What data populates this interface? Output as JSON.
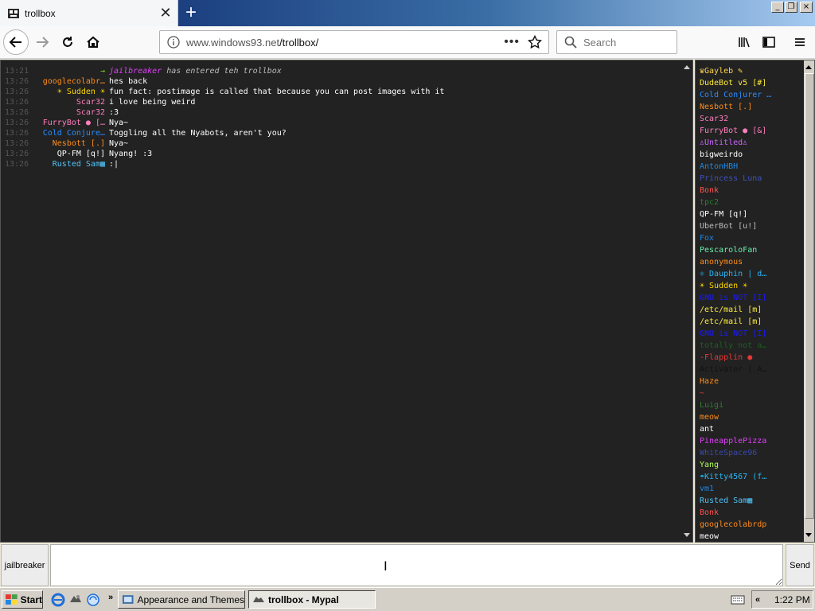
{
  "browser": {
    "tab_title": "trollbox",
    "new_tab": "+",
    "close_tab": "✕",
    "url_host": "www.windows93.net",
    "url_path": "/trollbox/",
    "url_dots": "•••",
    "search_placeholder": "Search",
    "window_controls": [
      "_",
      "❐",
      "×"
    ]
  },
  "chat": {
    "messages": [
      {
        "time": "13:21",
        "nick": "→",
        "text": "jailbreaker has entered teh trollbox",
        "system": true,
        "nick_color": "#7ddc1f"
      },
      {
        "time": "13:26",
        "nick": "googlecolabr…",
        "text": "hes back",
        "nick_color": "#ff8c1a"
      },
      {
        "time": "13:26",
        "nick": "☀ Sudden ☀",
        "text": "fun fact: postimage is called that because you can post images with it",
        "nick_color": "#ffd700"
      },
      {
        "time": "13:26",
        "nick": "Scar32",
        "text": "i love being weird",
        "nick_color": "#ff7fbf"
      },
      {
        "time": "13:26",
        "nick": "Scar32",
        "text": ":3",
        "nick_color": "#ff7fbf"
      },
      {
        "time": "13:26",
        "nick": "FurryBot ● […",
        "text": "Nya~",
        "nick_color": "#ff7fbf"
      },
      {
        "time": "13:26",
        "nick": "Cold Conjure…",
        "text": "Toggling all the Nyabots, aren't you?",
        "nick_color": "#2a8cff"
      },
      {
        "time": "13:26",
        "nick": "Nesbott [.]",
        "text": "Nya~",
        "nick_color": "#ff8c1a"
      },
      {
        "time": "13:26",
        "nick": "QP-FM [q!]",
        "text": "Nyang! :3",
        "nick_color": "#ffffff"
      },
      {
        "time": "13:26",
        "nick": "Rusted Sam▦",
        "text": ":|",
        "nick_color": "#4fc3f7"
      }
    ]
  },
  "users": [
    {
      "name": "♛Gayleb ✎",
      "color": "#ffd54f"
    },
    {
      "name": "DudeBot v5 [#]",
      "color": "#ffeb3b"
    },
    {
      "name": "Cold Conjurer …",
      "color": "#2a8cff"
    },
    {
      "name": "Nesbott [.]",
      "color": "#ff8c1a"
    },
    {
      "name": "Scar32",
      "color": "#ff7fbf"
    },
    {
      "name": "FurryBot ● [&]",
      "color": "#ff7fbf"
    },
    {
      "name": "♙Untitled♙",
      "color": "#cc66ff"
    },
    {
      "name": "bigweirdo",
      "color": "#ffffff"
    },
    {
      "name": "AntonHBH",
      "color": "#1e88e5"
    },
    {
      "name": "Princess Luna",
      "color": "#3f51b5"
    },
    {
      "name": "Bonk",
      "color": "#ff5252"
    },
    {
      "name": "tpc2",
      "color": "#2e7d32"
    },
    {
      "name": "QP-FM [q!]",
      "color": "#ffffff"
    },
    {
      "name": "UberBot [u!]",
      "color": "#bbbbbb"
    },
    {
      "name": "Fox",
      "color": "#1e88e5"
    },
    {
      "name": "PescaroloFan",
      "color": "#69f0ae"
    },
    {
      "name": "anonymous",
      "color": "#ff8c1a"
    },
    {
      "name": "⚛ Dauphin | d…",
      "color": "#29b6f6"
    },
    {
      "name": "☀ Sudden ☀",
      "color": "#ffd700"
    },
    {
      "name": "GNU is NOT [I]",
      "color": "#1a1aff"
    },
    {
      "name": "/etc/mail [m]",
      "color": "#ffeb3b"
    },
    {
      "name": "/etc/mail [m]",
      "color": "#ffeb3b"
    },
    {
      "name": "GNU is NOT [I]",
      "color": "#1a1aff"
    },
    {
      "name": "totally not a…",
      "color": "#1b5e20"
    },
    {
      "name": "-Flapplin ●",
      "color": "#e53935"
    },
    {
      "name": "Activator | A…",
      "color": "#111111"
    },
    {
      "name": "Haze",
      "color": "#ff8c1a"
    },
    {
      "name": "~",
      "color": "#e53935"
    },
    {
      "name": "Luigi",
      "color": "#2e7d32"
    },
    {
      "name": "meow",
      "color": "#ff8c1a"
    },
    {
      "name": "ant",
      "color": "#ffffff"
    },
    {
      "name": "PineapplePizza",
      "color": "#e040fb"
    },
    {
      "name": "WhiteSpace96",
      "color": "#3949ab"
    },
    {
      "name": "Yang",
      "color": "#b2ff59"
    },
    {
      "name": "☂Kitty4567 (f…",
      "color": "#29b6f6"
    },
    {
      "name": "vm1",
      "color": "#1e88e5"
    },
    {
      "name": "Rusted Sam▦",
      "color": "#4fc3f7"
    },
    {
      "name": "Bonk",
      "color": "#ff5252"
    },
    {
      "name": "googlecolabrdp",
      "color": "#ff8c1a"
    },
    {
      "name": "meow",
      "color": "#ffffff"
    }
  ],
  "input": {
    "nick_label": "jailbreaker",
    "send_label": "Send",
    "value": ""
  },
  "taskbar": {
    "start_label": "Start",
    "more": "»",
    "tasks": [
      {
        "label": "Appearance and Themes",
        "active": false
      },
      {
        "label": "trollbox - Mypal",
        "active": true
      }
    ],
    "tray_chevron": "«",
    "clock": "1:22 PM"
  }
}
